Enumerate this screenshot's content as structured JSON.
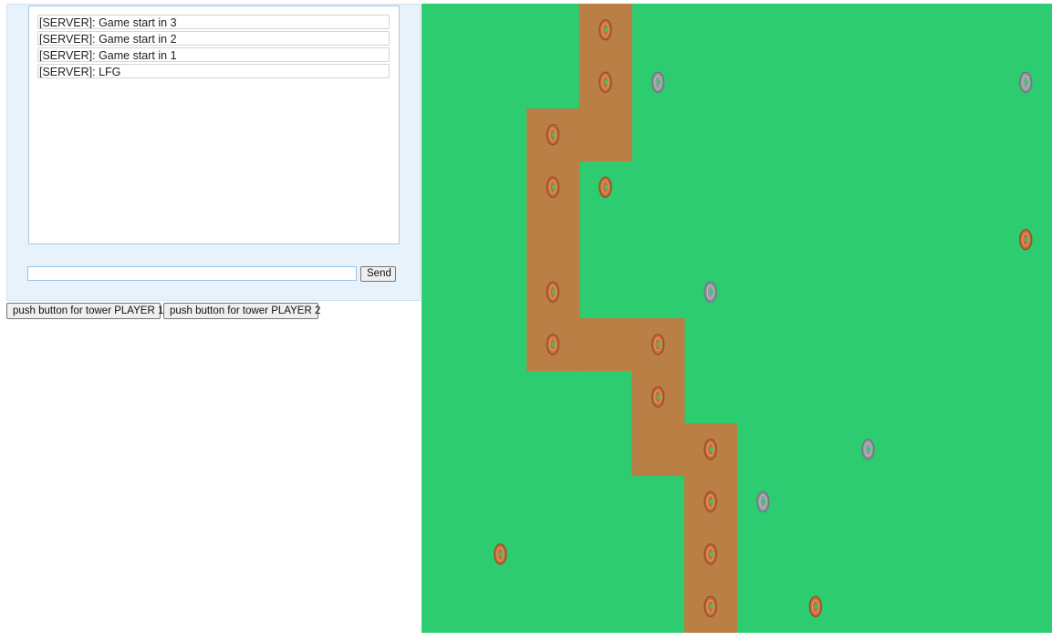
{
  "chat": {
    "messages": [
      "[SERVER]: Game start in 3",
      "[SERVER]: Game start in 2",
      "[SERVER]: Game start in 1",
      "[SERVER]: LFG"
    ],
    "input_value": "",
    "send_label": "Send"
  },
  "controls": {
    "tower_p1_label": "push button for tower PLAYER 1",
    "tower_p2_label": "push button for tower PLAYER 2"
  },
  "board": {
    "grid_cols": 12,
    "grid_rows": 12,
    "colors": {
      "grass": "#2ecc71",
      "path": "#b97f45",
      "player1_tower": "#c5703d",
      "player2_tower": "#929aa0"
    },
    "path_cells": [
      [
        3,
        0
      ],
      [
        3,
        1
      ],
      [
        2,
        2
      ],
      [
        3,
        2
      ],
      [
        2,
        3
      ],
      [
        2,
        4
      ],
      [
        2,
        5
      ],
      [
        2,
        6
      ],
      [
        3,
        6
      ],
      [
        4,
        6
      ],
      [
        4,
        7
      ],
      [
        4,
        8
      ],
      [
        5,
        8
      ],
      [
        5,
        9
      ],
      [
        5,
        10
      ],
      [
        5,
        11
      ]
    ],
    "towers": [
      {
        "col": 3,
        "row": 0,
        "owner": "player1"
      },
      {
        "col": 3,
        "row": 1,
        "owner": "player1"
      },
      {
        "col": 4,
        "row": 1,
        "owner": "player2"
      },
      {
        "col": 11,
        "row": 1,
        "owner": "player2"
      },
      {
        "col": 2,
        "row": 2,
        "owner": "player1"
      },
      {
        "col": 2,
        "row": 3,
        "owner": "player1"
      },
      {
        "col": 3,
        "row": 3,
        "owner": "player1"
      },
      {
        "col": 11,
        "row": 4,
        "owner": "player1"
      },
      {
        "col": 2,
        "row": 5,
        "owner": "player1"
      },
      {
        "col": 5,
        "row": 5,
        "owner": "player2"
      },
      {
        "col": 2,
        "row": 6,
        "owner": "player1"
      },
      {
        "col": 4,
        "row": 6,
        "owner": "player1"
      },
      {
        "col": 4,
        "row": 7,
        "owner": "player1"
      },
      {
        "col": 5,
        "row": 8,
        "owner": "player1"
      },
      {
        "col": 8,
        "row": 8,
        "owner": "player2"
      },
      {
        "col": 5,
        "row": 9,
        "owner": "player1"
      },
      {
        "col": 6,
        "row": 9,
        "owner": "player2"
      },
      {
        "col": 1,
        "row": 10,
        "owner": "player1"
      },
      {
        "col": 5,
        "row": 10,
        "owner": "player1"
      },
      {
        "col": 5,
        "row": 11,
        "owner": "player1"
      },
      {
        "col": 7,
        "row": 11,
        "owner": "player1"
      }
    ]
  }
}
